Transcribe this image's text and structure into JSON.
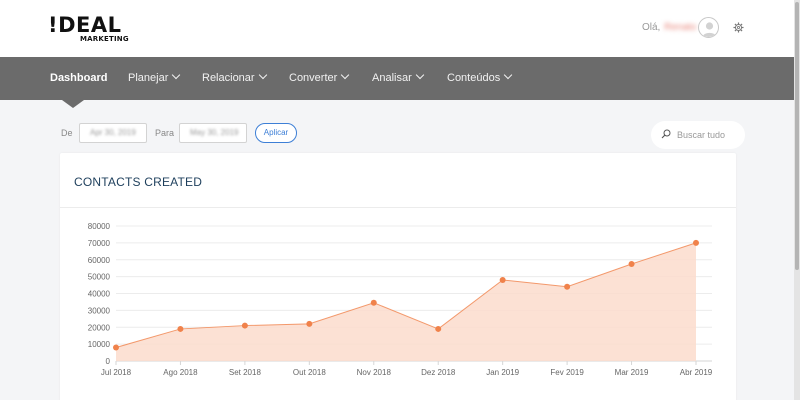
{
  "brand": {
    "logo_text": "!DEAL",
    "logo_sub": "MARKETING"
  },
  "header": {
    "greeting": "Olá,",
    "user_name": "Renato"
  },
  "nav": {
    "items": [
      {
        "label": "Dashboard",
        "active": true
      },
      {
        "label": "Planejar",
        "dropdown": true
      },
      {
        "label": "Relacionar",
        "dropdown": true
      },
      {
        "label": "Converter",
        "dropdown": true
      },
      {
        "label": "Analisar",
        "dropdown": true
      },
      {
        "label": "Conteúdos",
        "dropdown": true
      }
    ],
    "search_placeholder": "Buscar tudo"
  },
  "filters": {
    "from_label": "De",
    "from_value": "Apr 30, 2019",
    "to_label": "Para",
    "to_value": "May 30, 2019",
    "apply_label": "Aplicar"
  },
  "card": {
    "title": "CONTACTS CREATED"
  },
  "colors": {
    "nav_bg": "#6b6b6b",
    "accent": "#f0824b",
    "area_fill": "#fbdccd",
    "link_blue": "#3d7fd6"
  },
  "chart_data": {
    "type": "area",
    "categories": [
      "Jul 2018",
      "Ago 2018",
      "Set 2018",
      "Out 2018",
      "Nov 2018",
      "Dez 2018",
      "Jan 2019",
      "Fev 2019",
      "Mar 2019",
      "Abr 2019"
    ],
    "values": [
      8000,
      19000,
      21000,
      22000,
      34500,
      19000,
      48000,
      44000,
      57500,
      70000
    ],
    "yticks": [
      0,
      10000,
      20000,
      30000,
      40000,
      50000,
      60000,
      70000,
      80000
    ],
    "ylim": [
      0,
      80000
    ],
    "grid": true,
    "legend": false,
    "title": "CONTACTS CREATED"
  }
}
